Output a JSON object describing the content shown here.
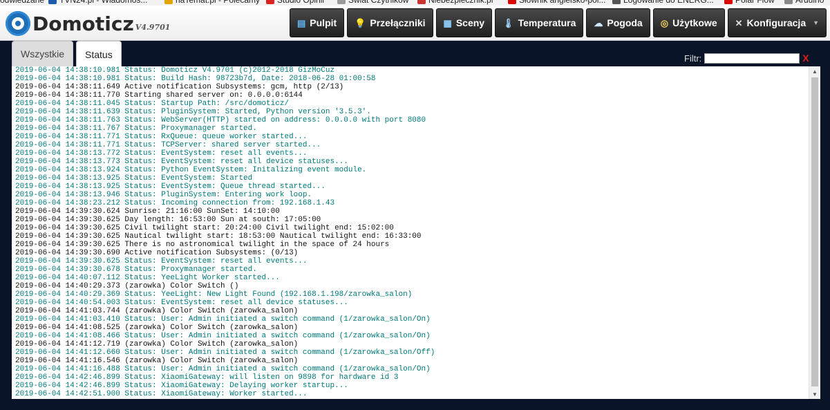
{
  "bookmarks": [
    {
      "label": "odwiedzane",
      "icon": "none"
    },
    {
      "label": "TVN24.pl - Wiadomoś...",
      "icon": "tvn24-icon"
    },
    {
      "label": "naTemat.pl - Polecamy",
      "icon": "natemat-icon"
    },
    {
      "label": "Studio Opinii",
      "icon": "studio-opinii-icon"
    },
    {
      "label": "Świat Czytników",
      "icon": "swiat-czytnikow-icon"
    },
    {
      "label": "Niebezpiecznik.pl",
      "icon": "niebezpiecznik-icon"
    },
    {
      "label": "Słownik angielsko-pol...",
      "icon": "slownik-icon"
    },
    {
      "label": "Logowanie do ENERG...",
      "icon": "energa-icon"
    },
    {
      "label": "Polar Flow",
      "icon": "polar-icon"
    },
    {
      "label": "Arduino",
      "icon": "arduino-icon"
    }
  ],
  "header": {
    "app_name": "Domoticz",
    "version": "V4.9701"
  },
  "nav": [
    {
      "label": "Pulpit",
      "icon": "dashboard-icon"
    },
    {
      "label": "Przełączniki",
      "icon": "lightbulb-icon"
    },
    {
      "label": "Sceny",
      "icon": "scenes-icon"
    },
    {
      "label": "Temperatura",
      "icon": "thermometer-icon"
    },
    {
      "label": "Pogoda",
      "icon": "weather-icon"
    },
    {
      "label": "Użytkowe",
      "icon": "utility-icon"
    },
    {
      "label": "Konfiguracja",
      "icon": "tools-icon",
      "dropdown": true
    }
  ],
  "tabs": [
    {
      "label": "Wszystkie",
      "active": false
    },
    {
      "label": "Status",
      "active": true
    }
  ],
  "filter": {
    "label": "Filtr:",
    "value": "",
    "clear": "X"
  },
  "colors": {
    "status_line": "#00797a",
    "plain_line": "#111111",
    "background": "#0a1428"
  },
  "log": [
    {
      "type": "status",
      "text": "2019-06-04 14:38:10.981 Status: Domoticz V4.9701 (c)2012-2018 GizMoCuz"
    },
    {
      "type": "status",
      "text": "2019-06-04 14:38:10.981 Status: Build Hash: 98723b7d, Date: 2018-06-28 01:00:58"
    },
    {
      "type": "plain",
      "text": "2019-06-04 14:38:11.649 Active notification Subsystems: gcm, http (2/13)"
    },
    {
      "type": "plain",
      "text": "2019-06-04 14:38:11.770 Starting shared server on: 0.0.0.0:6144"
    },
    {
      "type": "status",
      "text": "2019-06-04 14:38:11.045 Status: Startup Path: /src/domoticz/"
    },
    {
      "type": "status",
      "text": "2019-06-04 14:38:11.639 Status: PluginSystem: Started, Python version '3.5.3'."
    },
    {
      "type": "status",
      "text": "2019-06-04 14:38:11.763 Status: WebServer(HTTP) started on address: 0.0.0.0 with port 8080"
    },
    {
      "type": "status",
      "text": "2019-06-04 14:38:11.767 Status: Proxymanager started."
    },
    {
      "type": "status",
      "text": "2019-06-04 14:38:11.771 Status: RxQueue: queue worker started..."
    },
    {
      "type": "status",
      "text": "2019-06-04 14:38:11.771 Status: TCPServer: shared server started..."
    },
    {
      "type": "status",
      "text": "2019-06-04 14:38:13.772 Status: EventSystem: reset all events..."
    },
    {
      "type": "status",
      "text": "2019-06-04 14:38:13.773 Status: EventSystem: reset all device statuses..."
    },
    {
      "type": "status",
      "text": "2019-06-04 14:38:13.924 Status: Python EventSystem: Initalizing event module."
    },
    {
      "type": "status",
      "text": "2019-06-04 14:38:13.925 Status: EventSystem: Started"
    },
    {
      "type": "status",
      "text": "2019-06-04 14:38:13.925 Status: EventSystem: Queue thread started..."
    },
    {
      "type": "status",
      "text": "2019-06-04 14:38:13.946 Status: PluginSystem: Entering work loop."
    },
    {
      "type": "status",
      "text": "2019-06-04 14:38:23.212 Status: Incoming connection from: 192.168.1.43"
    },
    {
      "type": "plain",
      "text": "2019-06-04 14:39:30.624 Sunrise: 21:16:00 SunSet: 14:10:00"
    },
    {
      "type": "plain",
      "text": "2019-06-04 14:39:30.625 Day length: 16:53:00 Sun at south: 17:05:00"
    },
    {
      "type": "plain",
      "text": "2019-06-04 14:39:30.625 Civil twilight start: 20:24:00 Civil twilight end: 15:02:00"
    },
    {
      "type": "plain",
      "text": "2019-06-04 14:39:30.625 Nautical twilight start: 18:53:00 Nautical twilight end: 16:33:00"
    },
    {
      "type": "plain",
      "text": "2019-06-04 14:39:30.625 There is no astronomical twilight in the space of 24 hours"
    },
    {
      "type": "plain",
      "text": "2019-06-04 14:39:30.690 Active notification Subsystems: (0/13)"
    },
    {
      "type": "status",
      "text": "2019-06-04 14:39:30.625 Status: EventSystem: reset all events..."
    },
    {
      "type": "status",
      "text": "2019-06-04 14:39:30.678 Status: Proxymanager started."
    },
    {
      "type": "status",
      "text": "2019-06-04 14:40:07.112 Status: YeeLight Worker started..."
    },
    {
      "type": "plain",
      "text": "2019-06-04 14:40:29.373 (zarowka) Color Switch ()"
    },
    {
      "type": "status",
      "text": "2019-06-04 14:40:29.369 Status: YeeLight: New Light Found (192.168.1.198/zarowka_salon)"
    },
    {
      "type": "status",
      "text": "2019-06-04 14:40:54.003 Status: EventSystem: reset all device statuses..."
    },
    {
      "type": "plain",
      "text": "2019-06-04 14:41:03.744 (zarowka) Color Switch (zarowka_salon)"
    },
    {
      "type": "status",
      "text": "2019-06-04 14:41:03.410 Status: User: Admin initiated a switch command (1/zarowka_salon/On)"
    },
    {
      "type": "plain",
      "text": "2019-06-04 14:41:08.525 (zarowka) Color Switch (zarowka_salon)"
    },
    {
      "type": "status",
      "text": "2019-06-04 14:41:08.466 Status: User: Admin initiated a switch command (1/zarowka_salon/On)"
    },
    {
      "type": "plain",
      "text": "2019-06-04 14:41:12.719 (zarowka) Color Switch (zarowka_salon)"
    },
    {
      "type": "status",
      "text": "2019-06-04 14:41:12.660 Status: User: Admin initiated a switch command (1/zarowka_salon/Off)"
    },
    {
      "type": "plain",
      "text": "2019-06-04 14:41:16.546 (zarowka) Color Switch (zarowka_salon)"
    },
    {
      "type": "status",
      "text": "2019-06-04 14:41:16.488 Status: User: Admin initiated a switch command (1/zarowka_salon/On)"
    },
    {
      "type": "status",
      "text": "2019-06-04 14:42:46.899 Status: XiaomiGateway: will listen on 9898 for hardware id 3"
    },
    {
      "type": "status",
      "text": "2019-06-04 14:42:46.899 Status: XiaomiGateway: Delaying worker startup..."
    },
    {
      "type": "status",
      "text": "2019-06-04 14:42:51.900 Status: XiaomiGateway: Worker started..."
    }
  ]
}
